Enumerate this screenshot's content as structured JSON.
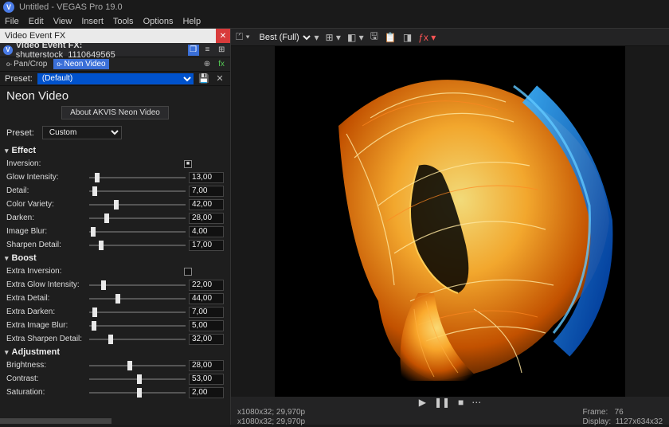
{
  "titlebar": {
    "title": "Untitled - VEGAS Pro 19.0",
    "logo": "V"
  },
  "menubar": {
    "items": [
      "File",
      "Edit",
      "View",
      "Insert",
      "Tools",
      "Options",
      "Help"
    ]
  },
  "fxwin": {
    "title": "Video Event FX",
    "header_prefix": "Video Event FX:",
    "clip_name": "shutterstock_1110649565",
    "chain": {
      "pancrop": "Pan/Crop",
      "neon": "Neon Video"
    },
    "preset_label": "Preset:",
    "preset_value": "(Default)",
    "plugin_title": "Neon Video",
    "about_btn": "About AKVIS Neon Video",
    "preset2_label": "Preset:",
    "preset2_value": "Custom",
    "groups": {
      "effect": {
        "title": "Effect",
        "params": [
          {
            "label": "Inversion:",
            "type": "check",
            "value": true
          },
          {
            "label": "Glow Intensity:",
            "type": "slider",
            "value": "13,00",
            "pos": 8
          },
          {
            "label": "Detail:",
            "type": "slider",
            "value": "7,00",
            "pos": 6
          },
          {
            "label": "Color Variety:",
            "type": "slider",
            "value": "42,00",
            "pos": 28
          },
          {
            "label": "Darken:",
            "type": "slider",
            "value": "28,00",
            "pos": 18
          },
          {
            "label": "Image Blur:",
            "type": "slider",
            "value": "4,00",
            "pos": 4
          },
          {
            "label": "Sharpen Detail:",
            "type": "slider",
            "value": "17,00",
            "pos": 12
          }
        ]
      },
      "boost": {
        "title": "Boost",
        "params": [
          {
            "label": "Extra Inversion:",
            "type": "check",
            "value": false
          },
          {
            "label": "Extra Glow Intensity:",
            "type": "slider",
            "value": "22,00",
            "pos": 15
          },
          {
            "label": "Extra Detail:",
            "type": "slider",
            "value": "44,00",
            "pos": 30
          },
          {
            "label": "Extra Darken:",
            "type": "slider",
            "value": "7,00",
            "pos": 6
          },
          {
            "label": "Extra Image Blur:",
            "type": "slider",
            "value": "5,00",
            "pos": 5
          },
          {
            "label": "Extra Sharpen Detail:",
            "type": "slider",
            "value": "32,00",
            "pos": 22
          }
        ]
      },
      "adjustment": {
        "title": "Adjustment",
        "params": [
          {
            "label": "Brightness:",
            "type": "slider",
            "value": "28,00",
            "pos": 42
          },
          {
            "label": "Contrast:",
            "type": "slider",
            "value": "53,00",
            "pos": 52
          },
          {
            "label": "Saturation:",
            "type": "slider",
            "value": "2,00",
            "pos": 52
          }
        ]
      }
    }
  },
  "preview": {
    "quality": "Best (Full)",
    "status_left": [
      "x1080x32; 29,970p",
      "x1080x32; 29,970p"
    ],
    "status_right_frame_label": "Frame:",
    "status_right_frame": "76",
    "status_right_display_label": "Display:",
    "status_right_display": "1127x634x32"
  }
}
